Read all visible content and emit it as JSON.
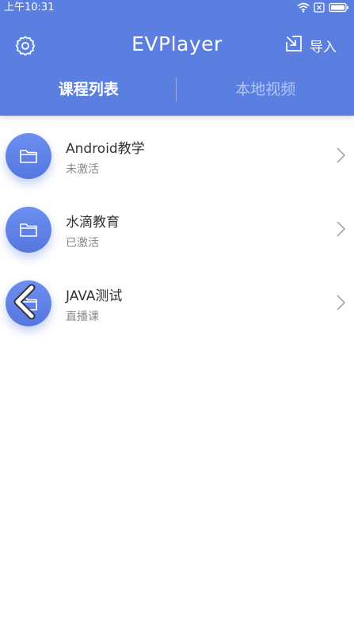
{
  "status_bar": {
    "time": "上午10:31",
    "icons": [
      "wifi-icon",
      "sim-off-icon",
      "battery-icon"
    ]
  },
  "toolbar": {
    "title": "EVPlayer",
    "settings_icon": "gear-icon",
    "import_label": "导入",
    "import_icon": "import-icon"
  },
  "tabs": [
    {
      "label": "课程列表",
      "active": true
    },
    {
      "label": "本地视频",
      "active": false
    }
  ],
  "courses": [
    {
      "title": "Android教学",
      "status": "未激活"
    },
    {
      "title": "水滴教育",
      "status": "已激活"
    },
    {
      "title": "JAVA测试",
      "status": "直播课"
    }
  ],
  "colors": {
    "primary": "#5a7fe0",
    "badge": "#6c8ff0",
    "title_text": "#333333",
    "sub_text": "#888888",
    "chevron": "#aaaaaa"
  }
}
